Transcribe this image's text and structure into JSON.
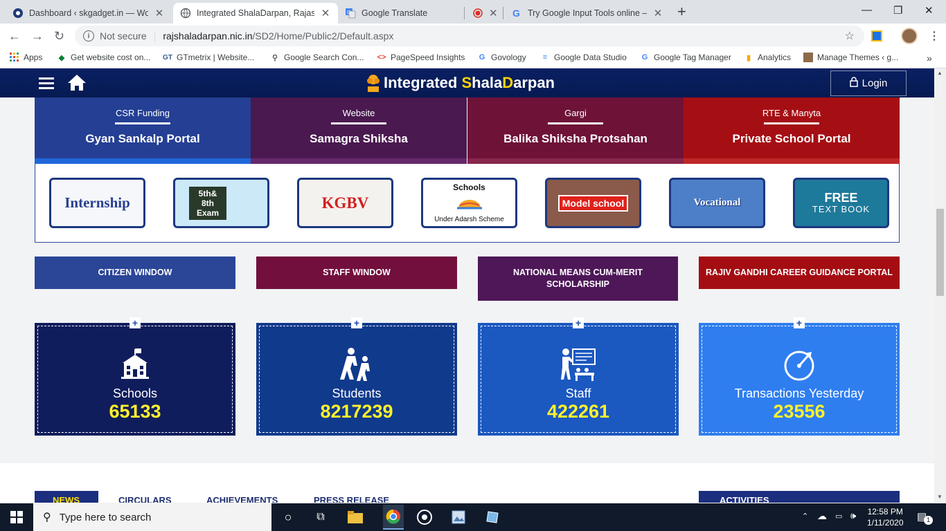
{
  "browser": {
    "tabs": [
      {
        "title": "Dashboard ‹ skgadget.in — Wor",
        "favicon": "wordpress-icon"
      },
      {
        "title": "Integrated ShalaDarpan, Rajastha",
        "favicon": "globe-icon"
      },
      {
        "title": "Google Translate",
        "favicon": "translate-icon"
      },
      {
        "title": "",
        "favicon": "record-icon"
      },
      {
        "title": "Try Google Input Tools online – G",
        "favicon": "google-icon"
      }
    ],
    "address": {
      "security": "Not secure",
      "domain": "rajshaladarpan.nic.in",
      "path": "/SD2/Home/Public2/Default.aspx"
    },
    "bookmarks": [
      "Apps",
      "Get website cost on...",
      "GTmetrix | Website...",
      "Google Search Con...",
      "PageSpeed Insights",
      "Govology",
      "Google Data Studio",
      "Google Tag Manager",
      "Analytics",
      "Manage Themes ‹ g..."
    ],
    "bookmarks_more": "»"
  },
  "site": {
    "title_part1": "Integrated ",
    "title_s": "S",
    "title_part2": "hala",
    "title_d": "D",
    "title_part3": "arpan",
    "login_label": "Login",
    "portals": [
      {
        "sub": "CSR Funding",
        "name": "Gyan Sankalp Portal",
        "color": "#253f94"
      },
      {
        "sub": "Website",
        "name": "Samagra Shiksha",
        "color": "#4a1950"
      },
      {
        "sub": "Gargi",
        "name": "Balika Shiksha Protsahan",
        "color": "#6e1238"
      },
      {
        "sub": "RTE & Manyta",
        "name": "Private School Portal",
        "color": "#a50f14"
      }
    ],
    "tiles": [
      {
        "label": "Internship"
      },
      {
        "label": "5th& 8th Exam"
      },
      {
        "label": "KGBV"
      },
      {
        "label_top": "Schools",
        "label_bottom": "Under Adarsh Scheme"
      },
      {
        "label": "Model school"
      },
      {
        "label": "Vocational"
      },
      {
        "label_top": "FREE",
        "label_bottom": "TEXT BOOK"
      }
    ],
    "windows": [
      {
        "label": "CITIZEN WINDOW",
        "color": "#2b4597"
      },
      {
        "label": "STAFF WINDOW",
        "color": "#720f3d"
      },
      {
        "label": "NATIONAL MEANS CUM-MERIT SCHOLARSHIP",
        "color": "#4e1758"
      },
      {
        "label": "RAJIV GANDHI CAREER GUIDANCE PORTAL",
        "color": "#a40d12"
      }
    ],
    "stats": [
      {
        "label": "Schools",
        "value": "65133",
        "icon": "school-icon",
        "color": "#101d5c"
      },
      {
        "label": "Students",
        "value": "8217239",
        "icon": "students-icon",
        "color": "#103a8c"
      },
      {
        "label": "Staff",
        "value": "422261",
        "icon": "staff-icon",
        "color": "#1b58c0"
      },
      {
        "label": "Transactions Yesterday",
        "value": "23556",
        "icon": "transactions-icon",
        "color": "#2f7ef0"
      }
    ],
    "plus": "+",
    "news_tabs": [
      "NEWS",
      "CIRCULARS",
      "ACHIEVEMENTS",
      "PRESS RELEASE"
    ],
    "activities": "ACTIVITIES"
  },
  "taskbar": {
    "search_placeholder": "Type here to search",
    "time": "12:58 PM",
    "date": "1/11/2020",
    "notifications": "1"
  }
}
